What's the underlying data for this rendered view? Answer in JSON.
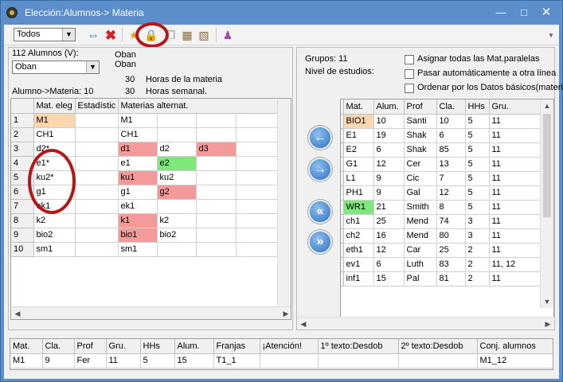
{
  "window": {
    "title": "Elección:Alumnos-> Materia"
  },
  "toolbar": {
    "combo_value": "Todos"
  },
  "left": {
    "alumnos_label": "112 Alumnos (V):",
    "prof1": "Oban",
    "prof2": "Oban",
    "combo_value": "Oban",
    "alumno_materia": "Alumno->Materia: 10",
    "horas_materia_num": "30",
    "horas_materia_label": "Horas de la materia",
    "horas_sem_num": "30",
    "horas_sem_label": "Horas semanal.",
    "headers": [
      "",
      "Mat. eleg",
      "Estadístic",
      "Materias alternat.",
      "",
      "",
      ""
    ],
    "rows": [
      {
        "n": "1",
        "c": [
          "M1",
          "",
          "M1",
          "",
          "",
          ""
        ],
        "s": [
          "sel",
          "",
          "",
          "",
          "",
          ""
        ]
      },
      {
        "n": "2",
        "c": [
          "CH1",
          "",
          "CH1",
          "",
          "",
          ""
        ],
        "s": [
          "",
          "",
          "",
          "",
          "",
          ""
        ]
      },
      {
        "n": "3",
        "c": [
          "d2*",
          "",
          "d1",
          "d2",
          "d3",
          ""
        ],
        "s": [
          "",
          "",
          "red",
          "",
          "red",
          ""
        ]
      },
      {
        "n": "4",
        "c": [
          "e1*",
          "",
          "e1",
          "e2",
          "",
          ""
        ],
        "s": [
          "",
          "",
          "",
          "grn",
          "",
          ""
        ]
      },
      {
        "n": "5",
        "c": [
          "ku2*",
          "",
          "ku1",
          "ku2",
          "",
          ""
        ],
        "s": [
          "",
          "",
          "red",
          "",
          "",
          ""
        ]
      },
      {
        "n": "6",
        "c": [
          "g1",
          "",
          "g1",
          "g2",
          "",
          ""
        ],
        "s": [
          "",
          "",
          "",
          "red",
          "",
          ""
        ]
      },
      {
        "n": "7",
        "c": [
          "ek1",
          "",
          "ek1",
          "",
          "",
          ""
        ],
        "s": [
          "",
          "",
          "",
          "",
          "",
          ""
        ]
      },
      {
        "n": "8",
        "c": [
          "k2",
          "",
          "k1",
          "k2",
          "",
          ""
        ],
        "s": [
          "",
          "",
          "red",
          "",
          "",
          ""
        ]
      },
      {
        "n": "9",
        "c": [
          "bio2",
          "",
          "bio1",
          "bio2",
          "",
          ""
        ],
        "s": [
          "",
          "",
          "red",
          "",
          "",
          ""
        ]
      },
      {
        "n": "10",
        "c": [
          "sm1",
          "",
          "sm1",
          "",
          "",
          ""
        ],
        "s": [
          "",
          "",
          "",
          "",
          "",
          ""
        ]
      }
    ]
  },
  "right": {
    "grupos": "Grupos: 11",
    "nivel": "Nivel de estudios:",
    "check1": "Asignar todas las Mat.paralelas",
    "check2": "Pasar automáticamente a otra línea",
    "check3": "Ordenar por los Datos básicos(materia)",
    "headers": [
      "",
      "Mat.",
      "Alum.",
      "Prof",
      "Cla.",
      "HHs",
      "Gru."
    ],
    "rows": [
      {
        "c": [
          "BIO1",
          "10",
          "Santi",
          "10",
          "5",
          "11"
        ],
        "s": "sel"
      },
      {
        "c": [
          "E1",
          "19",
          "Shak",
          "6",
          "5",
          "11"
        ],
        "s": ""
      },
      {
        "c": [
          "E2",
          "6",
          "Shak",
          "85",
          "5",
          "11"
        ],
        "s": ""
      },
      {
        "c": [
          "G1",
          "12",
          "Cer",
          "13",
          "5",
          "11"
        ],
        "s": ""
      },
      {
        "c": [
          "L1",
          "9",
          "Cic",
          "7",
          "5",
          "11"
        ],
        "s": ""
      },
      {
        "c": [
          "PH1",
          "9",
          "Gal",
          "12",
          "5",
          "11"
        ],
        "s": ""
      },
      {
        "c": [
          "WR1",
          "21",
          "Smith",
          "8",
          "5",
          "11"
        ],
        "s": "grn"
      },
      {
        "c": [
          "ch1",
          "25",
          "Mend",
          "74",
          "3",
          "11"
        ],
        "s": ""
      },
      {
        "c": [
          "ch2",
          "16",
          "Mend",
          "80",
          "3",
          "11"
        ],
        "s": ""
      },
      {
        "c": [
          "eth1",
          "12",
          "Car",
          "25",
          "2",
          "11"
        ],
        "s": ""
      },
      {
        "c": [
          "ev1",
          "6",
          "Luth",
          "83",
          "2",
          "11, 12"
        ],
        "s": ""
      },
      {
        "c": [
          "inf1",
          "15",
          "Pal",
          "81",
          "2",
          "11"
        ],
        "s": ""
      }
    ]
  },
  "bottom": {
    "headers": [
      "Mat.",
      "Cla.",
      "Prof",
      "Gru.",
      "HHs",
      "Alum.",
      "Franjas",
      "¡Atención!",
      "1º texto:Desdob",
      "2º texto:Desdob",
      "Conj. alumnos"
    ],
    "row": [
      "M1",
      "9",
      "Fer",
      "11",
      "5",
      "15",
      "T1_1",
      "",
      "",
      "",
      "M1_12"
    ]
  }
}
